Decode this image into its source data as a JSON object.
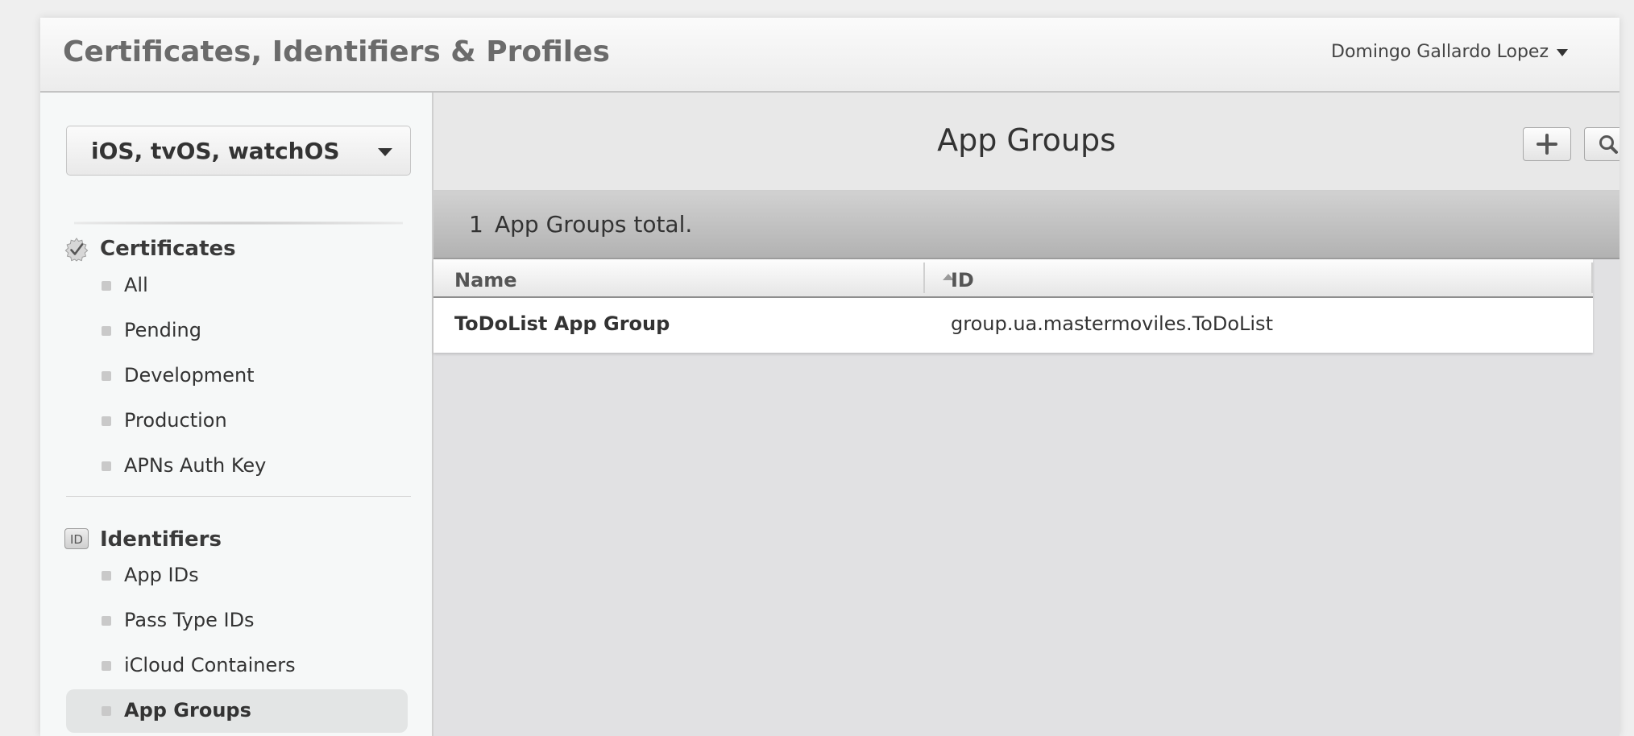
{
  "header": {
    "title": "Certificates, Identifiers & Profiles",
    "user": "Domingo Gallardo Lopez"
  },
  "sidebar": {
    "platform": "iOS, tvOS, watchOS",
    "sections": [
      {
        "label": "Certificates",
        "icon": "certificate-badge-icon",
        "items": [
          "All",
          "Pending",
          "Development",
          "Production",
          "APNs Auth Key"
        ]
      },
      {
        "label": "Identifiers",
        "icon": "id-badge-icon",
        "icon_text": "ID",
        "items": [
          "App IDs",
          "Pass Type IDs",
          "iCloud Containers",
          "App Groups"
        ]
      }
    ],
    "active_item": "App Groups"
  },
  "main": {
    "title": "App Groups",
    "add_icon": "plus-icon",
    "search_icon": "search-icon",
    "total_count": "1",
    "total_label": "App Groups total.",
    "columns": [
      "Name",
      "ID"
    ],
    "rows": [
      {
        "name": "ToDoList App Group",
        "id": "group.ua.mastermoviles.ToDoList"
      }
    ]
  },
  "colors": {
    "total_bar": "#b8b8b8",
    "sidebar_bg": "#f6f8f8",
    "active_item_bg": "#e3e5e5"
  }
}
